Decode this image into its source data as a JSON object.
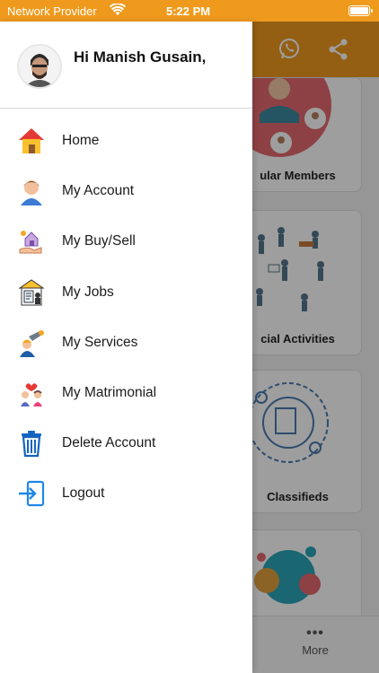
{
  "status_bar": {
    "carrier": "Network Provider",
    "time": "5:22 PM",
    "wifi_icon": "wifi-icon",
    "battery_icon": "battery-icon"
  },
  "header": {
    "whatsapp_icon": "whatsapp-icon",
    "share_icon": "share-icon",
    "color": "#ef9a1d"
  },
  "background": {
    "cards": [
      {
        "title": "ular Members"
      },
      {
        "title": "cial Activities"
      },
      {
        "title": "Classifieds"
      },
      {
        "title": ""
      }
    ],
    "more_tab_label": "More"
  },
  "drawer": {
    "greeting": "Hi Manish Gusain,",
    "items": [
      {
        "label": "Home",
        "icon": "home-icon"
      },
      {
        "label": "My Account",
        "icon": "user-icon"
      },
      {
        "label": "My Buy/Sell",
        "icon": "buy-sell-icon"
      },
      {
        "label": "My Jobs",
        "icon": "jobs-icon"
      },
      {
        "label": "My Services",
        "icon": "services-icon"
      },
      {
        "label": "My Matrimonial",
        "icon": "matrimonial-icon"
      },
      {
        "label": "Delete Account",
        "icon": "trash-icon"
      },
      {
        "label": "Logout",
        "icon": "logout-icon"
      }
    ]
  }
}
